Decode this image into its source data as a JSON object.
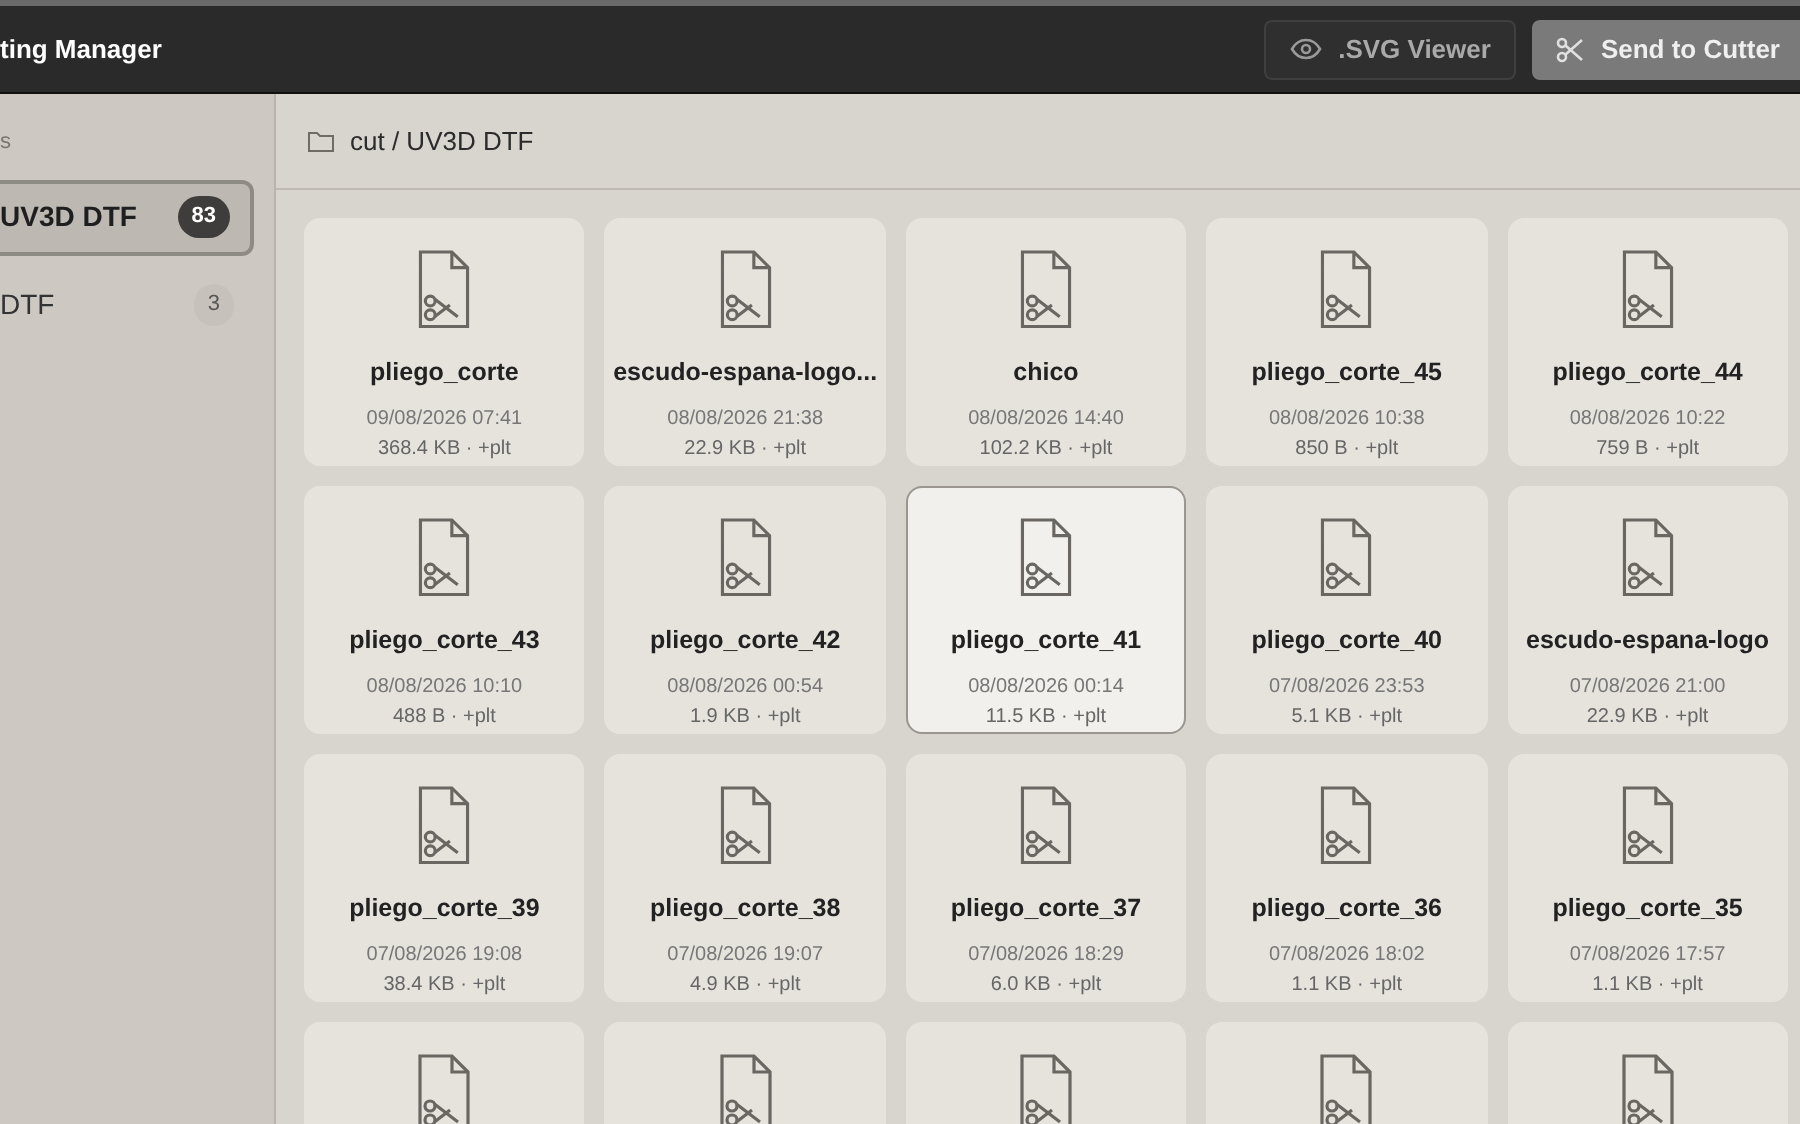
{
  "app_bar": {
    "title": "ting Manager",
    "buttons": [
      {
        "label": ".SVG Viewer",
        "kind": "outline"
      },
      {
        "label": "Send to Cutter",
        "kind": "filled"
      }
    ]
  },
  "sidebar": {
    "heading": "s",
    "items": [
      {
        "label": "UV3D DTF",
        "count": "83",
        "selected": true
      },
      {
        "label": "DTF",
        "count": "3",
        "selected": false
      }
    ]
  },
  "breadcrumb": "cut / UV3D DTF",
  "files": [
    {
      "name": "pliego_corte",
      "date": "09/08/2026 07:41",
      "info": "368.4 KB · +plt",
      "selected": false
    },
    {
      "name": "escudo-espana-logo...",
      "date": "08/08/2026 21:38",
      "info": "22.9 KB · +plt",
      "selected": false
    },
    {
      "name": "chico",
      "date": "08/08/2026 14:40",
      "info": "102.2 KB · +plt",
      "selected": false
    },
    {
      "name": "pliego_corte_45",
      "date": "08/08/2026 10:38",
      "info": "850 B · +plt",
      "selected": false
    },
    {
      "name": "pliego_corte_44",
      "date": "08/08/2026 10:22",
      "info": "759 B · +plt",
      "selected": false
    },
    {
      "name": "pliego_corte_43",
      "date": "08/08/2026 10:10",
      "info": "488 B · +plt",
      "selected": false
    },
    {
      "name": "pliego_corte_42",
      "date": "08/08/2026 00:54",
      "info": "1.9 KB · +plt",
      "selected": false
    },
    {
      "name": "pliego_corte_41",
      "date": "08/08/2026 00:14",
      "info": "11.5 KB · +plt",
      "selected": true
    },
    {
      "name": "pliego_corte_40",
      "date": "07/08/2026 23:53",
      "info": "5.1 KB · +plt",
      "selected": false
    },
    {
      "name": "escudo-espana-logo",
      "date": "07/08/2026 21:00",
      "info": "22.9 KB · +plt",
      "selected": false
    },
    {
      "name": "pliego_corte_39",
      "date": "07/08/2026 19:08",
      "info": "38.4 KB · +plt",
      "selected": false
    },
    {
      "name": "pliego_corte_38",
      "date": "07/08/2026 19:07",
      "info": "4.9 KB · +plt",
      "selected": false
    },
    {
      "name": "pliego_corte_37",
      "date": "07/08/2026 18:29",
      "info": "6.0 KB · +plt",
      "selected": false
    },
    {
      "name": "pliego_corte_36",
      "date": "07/08/2026 18:02",
      "info": "1.1 KB · +plt",
      "selected": false
    },
    {
      "name": "pliego_corte_35",
      "date": "07/08/2026 17:57",
      "info": "1.1 KB · +plt",
      "selected": false
    },
    {
      "selected": false
    },
    {
      "selected": false
    },
    {
      "selected": false
    },
    {
      "selected": false
    },
    {
      "selected": false
    }
  ]
}
